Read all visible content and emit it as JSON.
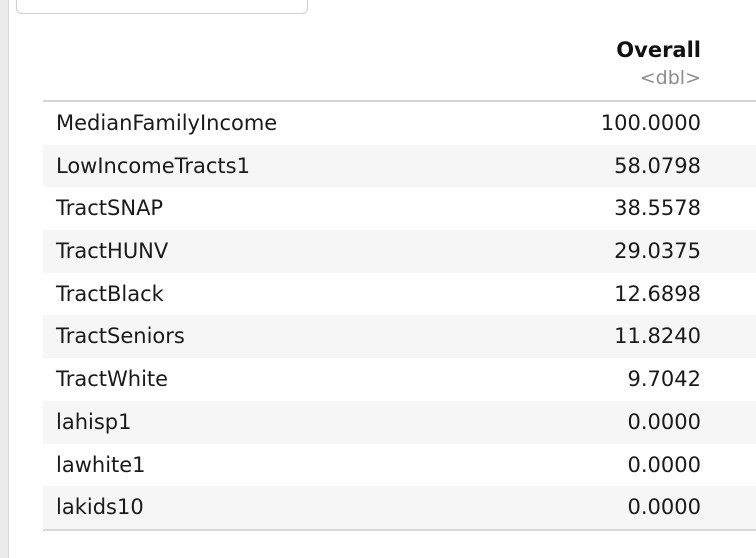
{
  "table": {
    "column_title": "Overall",
    "column_type": "<dbl>",
    "rows": [
      {
        "label": "MedianFamilyIncome",
        "value": "100.0000"
      },
      {
        "label": "LowIncomeTracts1",
        "value": "58.0798"
      },
      {
        "label": "TractSNAP",
        "value": "38.5578"
      },
      {
        "label": "TractHUNV",
        "value": "29.0375"
      },
      {
        "label": "TractBlack",
        "value": "12.6898"
      },
      {
        "label": "TractSeniors",
        "value": "11.8240"
      },
      {
        "label": "TractWhite",
        "value": "9.7042"
      },
      {
        "label": "lahisp1",
        "value": "0.0000"
      },
      {
        "label": "lawhite1",
        "value": "0.0000"
      },
      {
        "label": "lakids10",
        "value": "0.0000"
      }
    ]
  }
}
